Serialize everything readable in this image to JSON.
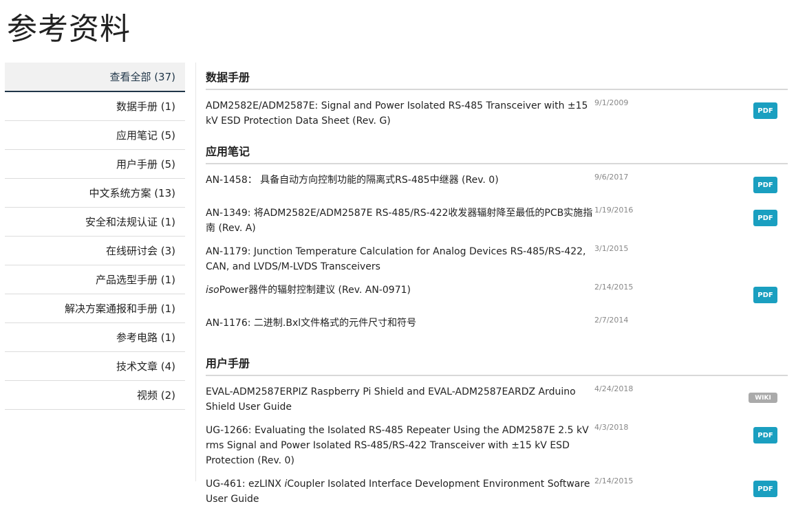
{
  "page_title": "参考资料",
  "sidebar": {
    "items": [
      {
        "label": "查看全部 (37)"
      },
      {
        "label": "数据手册 (1)"
      },
      {
        "label": "应用笔记 (5)"
      },
      {
        "label": "用户手册 (5)"
      },
      {
        "label": "中文系统方案 (13)"
      },
      {
        "label": "安全和法规认证 (1)"
      },
      {
        "label": "在线研讨会 (3)"
      },
      {
        "label": "产品选型手册 (1)"
      },
      {
        "label": "解决方案通报和手册 (1)"
      },
      {
        "label": "参考电路 (1)"
      },
      {
        "label": "技术文章 (4)"
      },
      {
        "label": "视频 (2)"
      }
    ]
  },
  "sections": {
    "datasheets": {
      "title": "数据手册",
      "docs": [
        {
          "title": "ADM2582E/ADM2587E: Signal and Power Isolated RS-485 Transceiver with ±15 kV ESD Protection Data Sheet (Rev. G)",
          "date": "9/1/2009",
          "badge": "PDF"
        }
      ]
    },
    "app_notes": {
      "title": "应用笔记",
      "docs": [
        {
          "title": "AN-1458： 具备自动方向控制功能的隔离式RS-485中继器 (Rev. 0)",
          "date": "9/6/2017",
          "badge": "PDF"
        },
        {
          "title": "AN-1349: 将ADM2582E/ADM2587E RS-485/RS-422收发器辐射降至最低的PCB实施指南 (Rev. A)",
          "date": "1/19/2016",
          "badge": "PDF"
        },
        {
          "title": "AN-1179: Junction Temperature Calculation for Analog Devices RS-485/RS-422, CAN, and LVDS/M-LVDS Transceivers",
          "date": "3/1/2015",
          "badge": ""
        },
        {
          "title_italic": "iso",
          "title": "Power器件的辐射控制建议 (Rev. AN-0971)",
          "date": "2/14/2015",
          "badge": "PDF"
        },
        {
          "title": "AN-1176: 二进制.Bxl文件格式的元件尺寸和符号",
          "date": "2/7/2014",
          "badge": ""
        }
      ]
    },
    "user_guides": {
      "title": "用户手册",
      "docs": [
        {
          "title": "EVAL-ADM2587ERPIZ Raspberry Pi Shield and EVAL-ADM2587EARDZ Arduino Shield User Guide",
          "date": "4/24/2018",
          "badge": "WIKI"
        },
        {
          "title": "UG-1266: Evaluating the Isolated RS-485 Repeater Using the ADM2587E 2.5 kV rms Signal and Power Isolated RS-485/RS-422 Transceiver with ±15 kV ESD Protection (Rev. 0)",
          "date": "4/3/2018",
          "badge": "PDF"
        },
        {
          "title_prefix": "UG-461: ezLINX ",
          "title_italic": "i",
          "title": "Coupler Isolated Interface Development Environment Software User Guide",
          "date": "2/14/2015",
          "badge": "PDF"
        }
      ]
    }
  }
}
